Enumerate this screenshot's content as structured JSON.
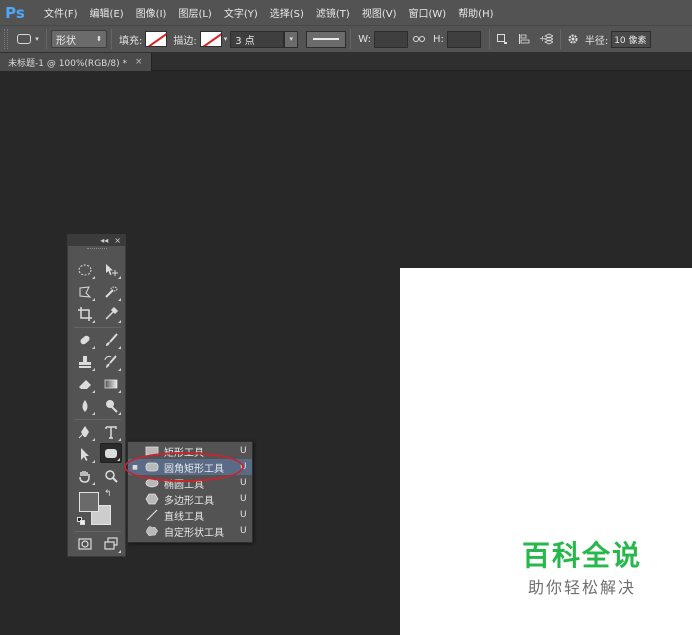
{
  "app": {
    "logo": "Ps"
  },
  "menu": [
    "文件(F)",
    "编辑(E)",
    "图像(I)",
    "图层(L)",
    "文字(Y)",
    "选择(S)",
    "滤镜(T)",
    "视图(V)",
    "窗口(W)",
    "帮助(H)"
  ],
  "options": {
    "mode": "形状",
    "fill_label": "填充:",
    "stroke_label": "描边:",
    "stroke_width": "3 点",
    "w_label": "W:",
    "w_value": "",
    "h_label": "H:",
    "h_value": "",
    "radius_label": "半径:",
    "radius_value": "10 像素",
    "icons": [
      "rounded-rectangle-icon",
      "path-operations-icon",
      "path-alignment-icon",
      "path-arrangement-icon",
      "gear-icon",
      "link-icon"
    ]
  },
  "document_tab": {
    "title": "未标题-1 @ 100%(RGB/8) *",
    "close": "×"
  },
  "toolbox": {
    "collapse": "◂◂",
    "close": "×",
    "tools": [
      "marquee-icon",
      "move-icon",
      "lasso-icon",
      "quick-selection-icon",
      "crop-icon",
      "eyedropper-icon",
      "spot-healing-icon",
      "brush-icon",
      "clone-stamp-icon",
      "history-brush-icon",
      "eraser-icon",
      "gradient-icon",
      "blur-icon",
      "dodge-icon",
      "pen-icon",
      "type-icon",
      "path-selection-icon",
      "rounded-rectangle-icon",
      "hand-icon",
      "zoom-icon",
      "quick-mask-icon",
      "screen-mode-icon"
    ],
    "foreground_color": "#6a6a6a",
    "background_color": "#cdcdcd"
  },
  "flyout": {
    "items": [
      {
        "label": "矩形工具",
        "key": "U",
        "icon": "rectangle-icon",
        "active": false
      },
      {
        "label": "圆角矩形工具",
        "key": "U",
        "icon": "rounded-rectangle-icon",
        "active": true
      },
      {
        "label": "椭圆工具",
        "key": "U",
        "icon": "ellipse-icon",
        "active": false
      },
      {
        "label": "多边形工具",
        "key": "U",
        "icon": "polygon-icon",
        "active": false
      },
      {
        "label": "直线工具",
        "key": "U",
        "icon": "line-icon",
        "active": false
      },
      {
        "label": "自定形状工具",
        "key": "U",
        "icon": "custom-shape-icon",
        "active": false
      }
    ],
    "bullet": "■"
  },
  "watermark": {
    "title": "百科全说",
    "subtitle": "助你轻松解决",
    "color": "#26b84a"
  },
  "colors": {
    "highlight_ellipse": "#c4262f",
    "ps_blue": "#4ea6f7",
    "canvas": "#ffffff"
  }
}
